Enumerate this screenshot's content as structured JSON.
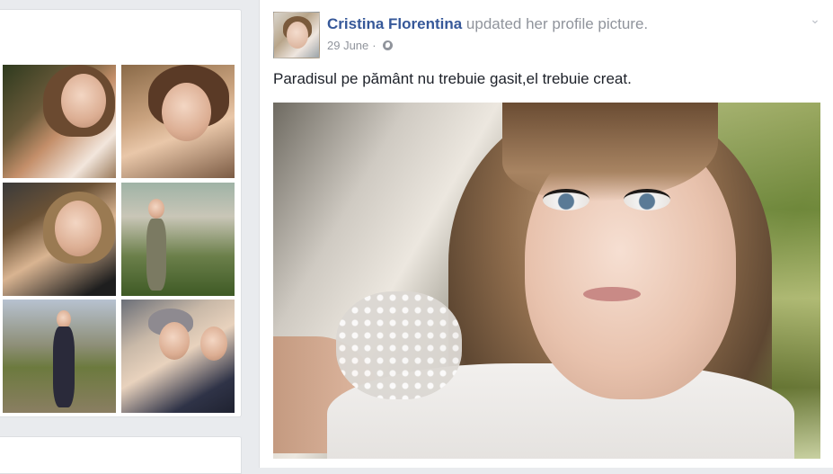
{
  "left_panel": {
    "photos": [
      {
        "icon": "profile-photo-1"
      },
      {
        "icon": "profile-photo-2"
      },
      {
        "icon": "profile-photo-3"
      },
      {
        "icon": "profile-photo-4"
      },
      {
        "icon": "profile-photo-5"
      },
      {
        "icon": "profile-photo-6"
      }
    ]
  },
  "post": {
    "author": "Cristina Florentina",
    "action": " updated her profile picture.",
    "date": "29 June",
    "separator": "·",
    "privacy_icon": "globe-icon",
    "menu_icon": "chevron-down-icon",
    "text": "Paradisul pe pământ nu trebuie gasit,el trebuie creat.",
    "colors": {
      "author": "#365899",
      "meta": "#90949c",
      "text": "#1d2129",
      "background": "#e9ebee"
    }
  }
}
